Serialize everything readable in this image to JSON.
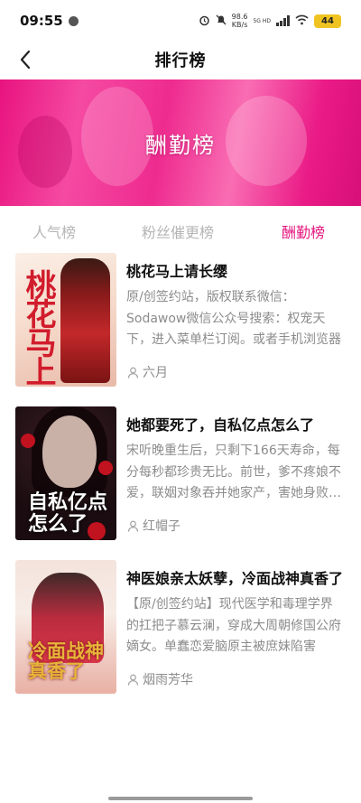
{
  "status_bar": {
    "time": "09:55",
    "speed_value": "98.6",
    "speed_unit": "KB/s",
    "net_top": "5G HD",
    "net_bottom": "",
    "battery": "44"
  },
  "nav": {
    "title": "排行榜"
  },
  "banner": {
    "title": "酬勤榜"
  },
  "tabs": [
    {
      "label": "人气榜",
      "active": false
    },
    {
      "label": "粉丝催更榜",
      "active": false
    },
    {
      "label": "酬勤榜",
      "active": true
    }
  ],
  "books": [
    {
      "title": "桃花马上请长缨",
      "description": "原/创签约站，版权联系微信：Sodawow微信公众号搜索：权宠天下，进入菜单栏订阅。或者手机浏览器",
      "author": "六月",
      "cover_text": "桃花马上"
    },
    {
      "title": "她都要死了，自私亿点怎么了",
      "description": "宋听晚重生后，只剩下166天寿命，每分每秒都珍贵无比。前世，爹不疼娘不爱，联姻对象吞并她家产，害她身败名裂",
      "author": "红帽子",
      "cover_text": "自私亿点怎么了"
    },
    {
      "title": "神医娘亲太妖孽，冷面战神真香了",
      "description": "【原/创签约站】现代医学和毒理学界的扛把子慕云澜，穿成大周朝修国公府嫡女。单蠢恋爱脑原主被庶妹陷害",
      "author": "烟雨芳华",
      "cover_text": "冷面战神真香了"
    }
  ],
  "colors": {
    "accent": "#e5167f",
    "banner_gradient": [
      "#e8137f",
      "#f96db3"
    ],
    "inactive_tab": "#b5b5b5",
    "muted_text": "#8c8c8c"
  }
}
